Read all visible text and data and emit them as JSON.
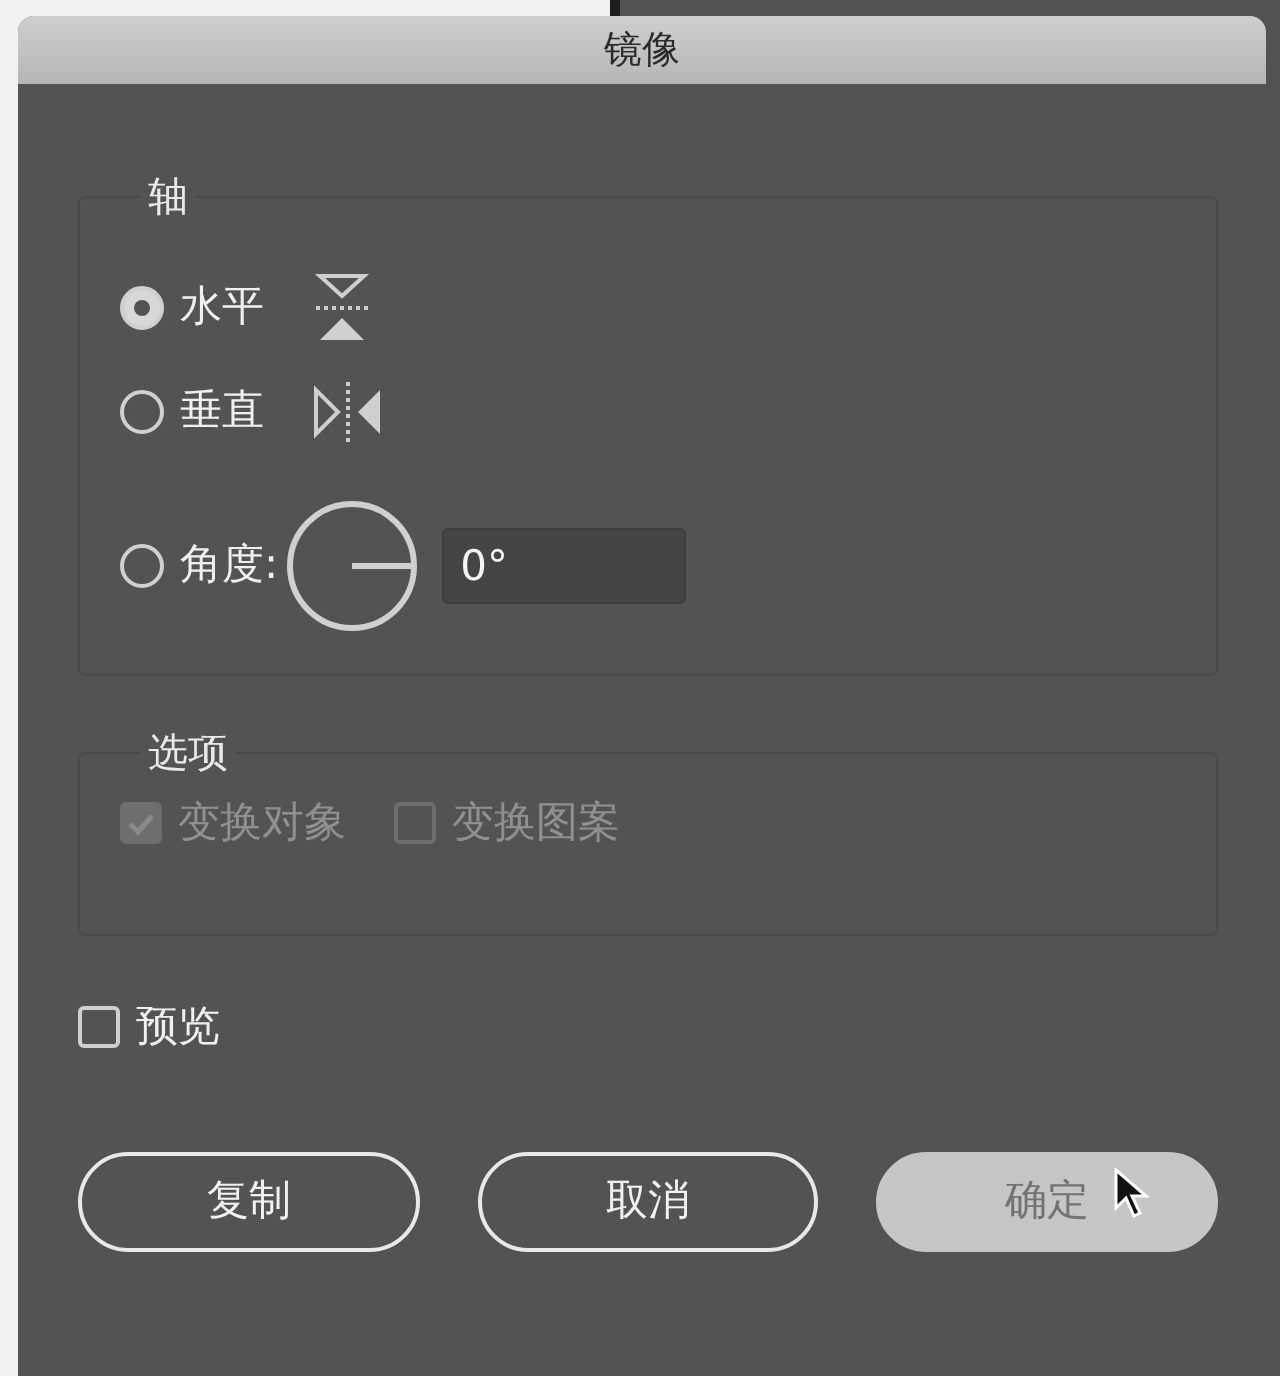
{
  "window": {
    "title": "镜像"
  },
  "axis": {
    "label": "轴",
    "options": [
      {
        "label": "水平",
        "kind": "horizontal",
        "selected": true
      },
      {
        "label": "垂直",
        "kind": "vertical",
        "selected": false
      },
      {
        "label": "角度:",
        "kind": "angle",
        "selected": false
      }
    ],
    "angle_value": "0°"
  },
  "options": {
    "label": "选项",
    "disabled": true,
    "items": [
      {
        "label": "变换对象",
        "checked": true
      },
      {
        "label": "变换图案",
        "checked": false
      }
    ]
  },
  "preview": {
    "label": "预览",
    "checked": false
  },
  "buttons": [
    {
      "label": "复制",
      "kind": "outline"
    },
    {
      "label": "取消",
      "kind": "outline"
    },
    {
      "label": "确定",
      "kind": "default"
    }
  ]
}
